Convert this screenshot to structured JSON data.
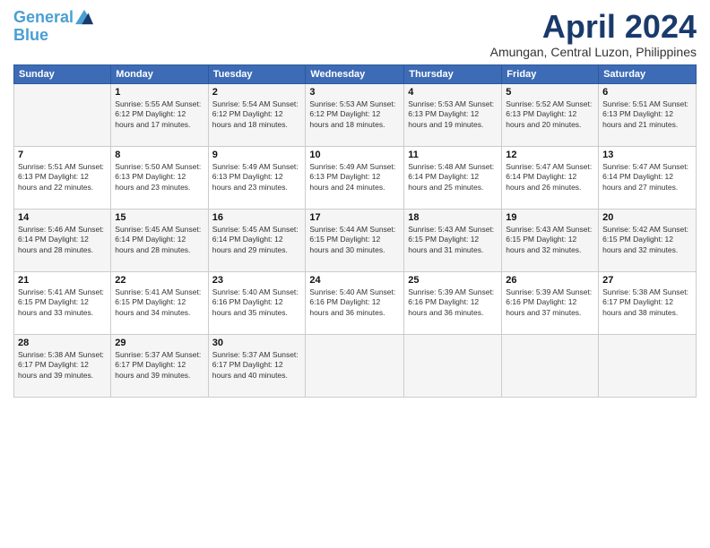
{
  "logo": {
    "line1": "General",
    "line2": "Blue"
  },
  "title": "April 2024",
  "location": "Amungan, Central Luzon, Philippines",
  "header": {
    "days": [
      "Sunday",
      "Monday",
      "Tuesday",
      "Wednesday",
      "Thursday",
      "Friday",
      "Saturday"
    ]
  },
  "weeks": [
    [
      {
        "day": "",
        "info": ""
      },
      {
        "day": "1",
        "info": "Sunrise: 5:55 AM\nSunset: 6:12 PM\nDaylight: 12 hours\nand 17 minutes."
      },
      {
        "day": "2",
        "info": "Sunrise: 5:54 AM\nSunset: 6:12 PM\nDaylight: 12 hours\nand 18 minutes."
      },
      {
        "day": "3",
        "info": "Sunrise: 5:53 AM\nSunset: 6:12 PM\nDaylight: 12 hours\nand 18 minutes."
      },
      {
        "day": "4",
        "info": "Sunrise: 5:53 AM\nSunset: 6:13 PM\nDaylight: 12 hours\nand 19 minutes."
      },
      {
        "day": "5",
        "info": "Sunrise: 5:52 AM\nSunset: 6:13 PM\nDaylight: 12 hours\nand 20 minutes."
      },
      {
        "day": "6",
        "info": "Sunrise: 5:51 AM\nSunset: 6:13 PM\nDaylight: 12 hours\nand 21 minutes."
      }
    ],
    [
      {
        "day": "7",
        "info": "Sunrise: 5:51 AM\nSunset: 6:13 PM\nDaylight: 12 hours\nand 22 minutes."
      },
      {
        "day": "8",
        "info": "Sunrise: 5:50 AM\nSunset: 6:13 PM\nDaylight: 12 hours\nand 23 minutes."
      },
      {
        "day": "9",
        "info": "Sunrise: 5:49 AM\nSunset: 6:13 PM\nDaylight: 12 hours\nand 23 minutes."
      },
      {
        "day": "10",
        "info": "Sunrise: 5:49 AM\nSunset: 6:13 PM\nDaylight: 12 hours\nand 24 minutes."
      },
      {
        "day": "11",
        "info": "Sunrise: 5:48 AM\nSunset: 6:14 PM\nDaylight: 12 hours\nand 25 minutes."
      },
      {
        "day": "12",
        "info": "Sunrise: 5:47 AM\nSunset: 6:14 PM\nDaylight: 12 hours\nand 26 minutes."
      },
      {
        "day": "13",
        "info": "Sunrise: 5:47 AM\nSunset: 6:14 PM\nDaylight: 12 hours\nand 27 minutes."
      }
    ],
    [
      {
        "day": "14",
        "info": "Sunrise: 5:46 AM\nSunset: 6:14 PM\nDaylight: 12 hours\nand 28 minutes."
      },
      {
        "day": "15",
        "info": "Sunrise: 5:45 AM\nSunset: 6:14 PM\nDaylight: 12 hours\nand 28 minutes."
      },
      {
        "day": "16",
        "info": "Sunrise: 5:45 AM\nSunset: 6:14 PM\nDaylight: 12 hours\nand 29 minutes."
      },
      {
        "day": "17",
        "info": "Sunrise: 5:44 AM\nSunset: 6:15 PM\nDaylight: 12 hours\nand 30 minutes."
      },
      {
        "day": "18",
        "info": "Sunrise: 5:43 AM\nSunset: 6:15 PM\nDaylight: 12 hours\nand 31 minutes."
      },
      {
        "day": "19",
        "info": "Sunrise: 5:43 AM\nSunset: 6:15 PM\nDaylight: 12 hours\nand 32 minutes."
      },
      {
        "day": "20",
        "info": "Sunrise: 5:42 AM\nSunset: 6:15 PM\nDaylight: 12 hours\nand 32 minutes."
      }
    ],
    [
      {
        "day": "21",
        "info": "Sunrise: 5:41 AM\nSunset: 6:15 PM\nDaylight: 12 hours\nand 33 minutes."
      },
      {
        "day": "22",
        "info": "Sunrise: 5:41 AM\nSunset: 6:15 PM\nDaylight: 12 hours\nand 34 minutes."
      },
      {
        "day": "23",
        "info": "Sunrise: 5:40 AM\nSunset: 6:16 PM\nDaylight: 12 hours\nand 35 minutes."
      },
      {
        "day": "24",
        "info": "Sunrise: 5:40 AM\nSunset: 6:16 PM\nDaylight: 12 hours\nand 36 minutes."
      },
      {
        "day": "25",
        "info": "Sunrise: 5:39 AM\nSunset: 6:16 PM\nDaylight: 12 hours\nand 36 minutes."
      },
      {
        "day": "26",
        "info": "Sunrise: 5:39 AM\nSunset: 6:16 PM\nDaylight: 12 hours\nand 37 minutes."
      },
      {
        "day": "27",
        "info": "Sunrise: 5:38 AM\nSunset: 6:17 PM\nDaylight: 12 hours\nand 38 minutes."
      }
    ],
    [
      {
        "day": "28",
        "info": "Sunrise: 5:38 AM\nSunset: 6:17 PM\nDaylight: 12 hours\nand 39 minutes."
      },
      {
        "day": "29",
        "info": "Sunrise: 5:37 AM\nSunset: 6:17 PM\nDaylight: 12 hours\nand 39 minutes."
      },
      {
        "day": "30",
        "info": "Sunrise: 5:37 AM\nSunset: 6:17 PM\nDaylight: 12 hours\nand 40 minutes."
      },
      {
        "day": "",
        "info": ""
      },
      {
        "day": "",
        "info": ""
      },
      {
        "day": "",
        "info": ""
      },
      {
        "day": "",
        "info": ""
      }
    ]
  ]
}
